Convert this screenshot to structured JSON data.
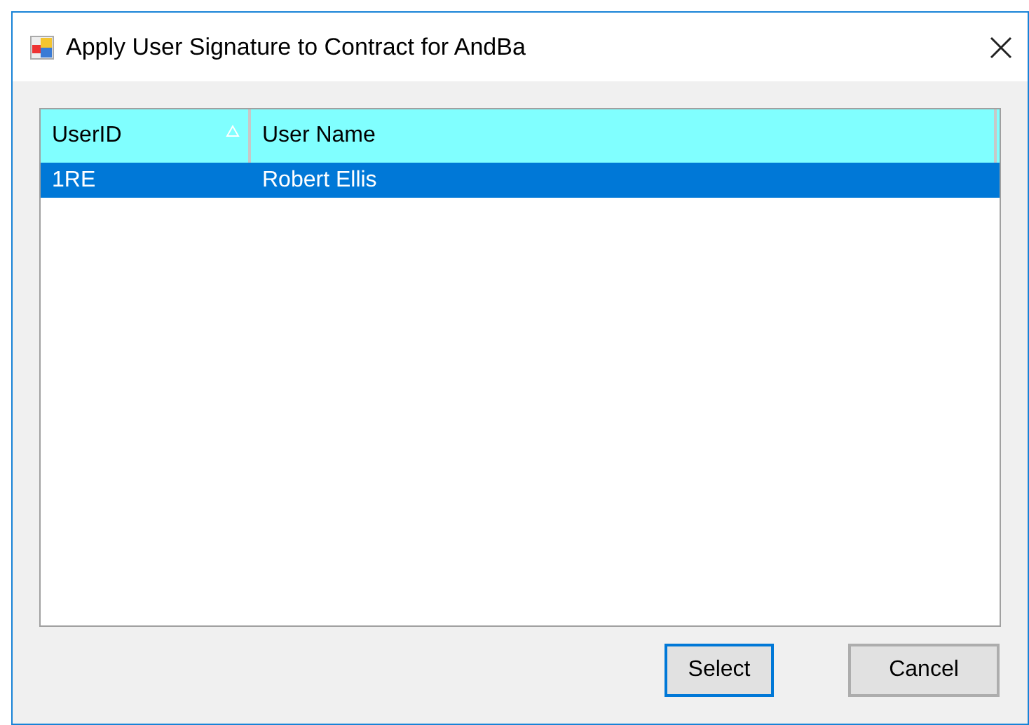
{
  "window": {
    "title": "Apply User Signature to Contract for AndBa"
  },
  "table": {
    "columns": [
      {
        "label": "UserID",
        "sorted": true
      },
      {
        "label": "User Name",
        "sorted": false
      }
    ],
    "rows": [
      {
        "cells": [
          "1RE",
          "Robert Ellis"
        ],
        "selected": true
      }
    ]
  },
  "buttons": [
    {
      "label": "Select",
      "default": true
    },
    {
      "label": "Cancel",
      "default": false
    }
  ]
}
